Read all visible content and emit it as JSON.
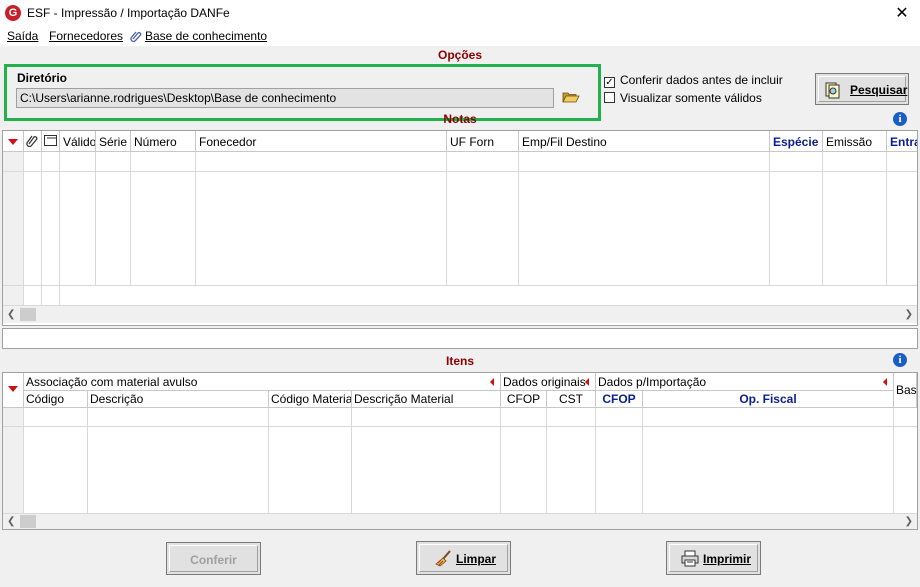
{
  "window": {
    "title": "ESF - Impressão / Importação DANFe",
    "app_icon_letter": "G",
    "close_glyph": "✕"
  },
  "menu": {
    "items": [
      "Saída",
      "Fornecedores",
      "Base de conhecimento"
    ]
  },
  "options": {
    "section_title": "Opções",
    "directory_label": "Diretório",
    "directory_value": "C:\\Users\\arianne.rodrigues\\Desktop\\Base de conhecimento",
    "check_conferir": "Conferir dados antes de incluir",
    "check_conferir_checked": true,
    "check_visualizar": "Visualizar somente válidos",
    "check_visualizar_checked": false,
    "search_button": "Pesquisar"
  },
  "notas": {
    "section_title": "Notas",
    "columns": [
      "Válido",
      "Série",
      "Número",
      "Fonecedor",
      "UF Forn",
      "Emp/Fil Destino",
      "Espécie",
      "Emissão",
      "Entra"
    ]
  },
  "itens": {
    "section_title": "Itens",
    "groups": [
      "Associação com material avulso",
      "Dados originais",
      "Dados p/Importação",
      "Base"
    ],
    "columns": [
      "Código",
      "Descrição",
      "Código Material",
      "Descrição Material",
      "CFOP",
      "CST",
      "CFOP",
      "Op. Fiscal"
    ]
  },
  "buttons": {
    "conferir": "Conferir",
    "limpar": "Limpar",
    "imprimir": "Imprimir"
  },
  "colors": {
    "accent_red": "#8b0000",
    "highlight_green": "#22b14c",
    "header_blue": "#0a1f8f"
  },
  "icons": [
    "app-logo-icon",
    "close-icon",
    "paperclip-icon",
    "folder-open-icon",
    "search-docs-icon",
    "info-icon",
    "attachment-icon",
    "document-icon",
    "broom-icon",
    "printer-icon"
  ]
}
